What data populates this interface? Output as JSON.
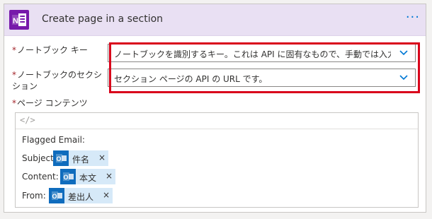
{
  "card": {
    "title": "Create page in a section",
    "more_label": "···",
    "app_icon_letter": "N"
  },
  "fields": [
    {
      "label": "ノートブック キー",
      "value": "ノートブックを識別するキー。これは API に固有なもので、手動では入力できません。"
    },
    {
      "label_line1": "ノートブックのセクシ",
      "label_line2": "ション",
      "value": "セクション ページの API の URL です。"
    }
  ],
  "content": {
    "label": "ページ コンテンツ",
    "code_icon": "</>",
    "heading": "Flagged Email:",
    "rows": [
      {
        "label": "Subject:",
        "token": "件名",
        "remove": "×"
      },
      {
        "label": "Content:",
        "token": "本文",
        "remove": "×"
      },
      {
        "label": "From:",
        "token": "差出人",
        "remove": "×"
      }
    ]
  },
  "required_mark": "*",
  "colors": {
    "header_bg": "#e9e0f3",
    "onenote_purple": "#7719aa",
    "outlook_blue": "#0f6cbd",
    "token_bg": "#d6e9f8",
    "highlight_red": "#d9001b",
    "link_blue": "#0078d4"
  },
  "icons": {
    "app": "onenote-icon",
    "dropdown": "chevron-down-icon",
    "token": "outlook-icon",
    "editor_mode": "code-view-icon",
    "menu": "ellipsis-icon"
  }
}
